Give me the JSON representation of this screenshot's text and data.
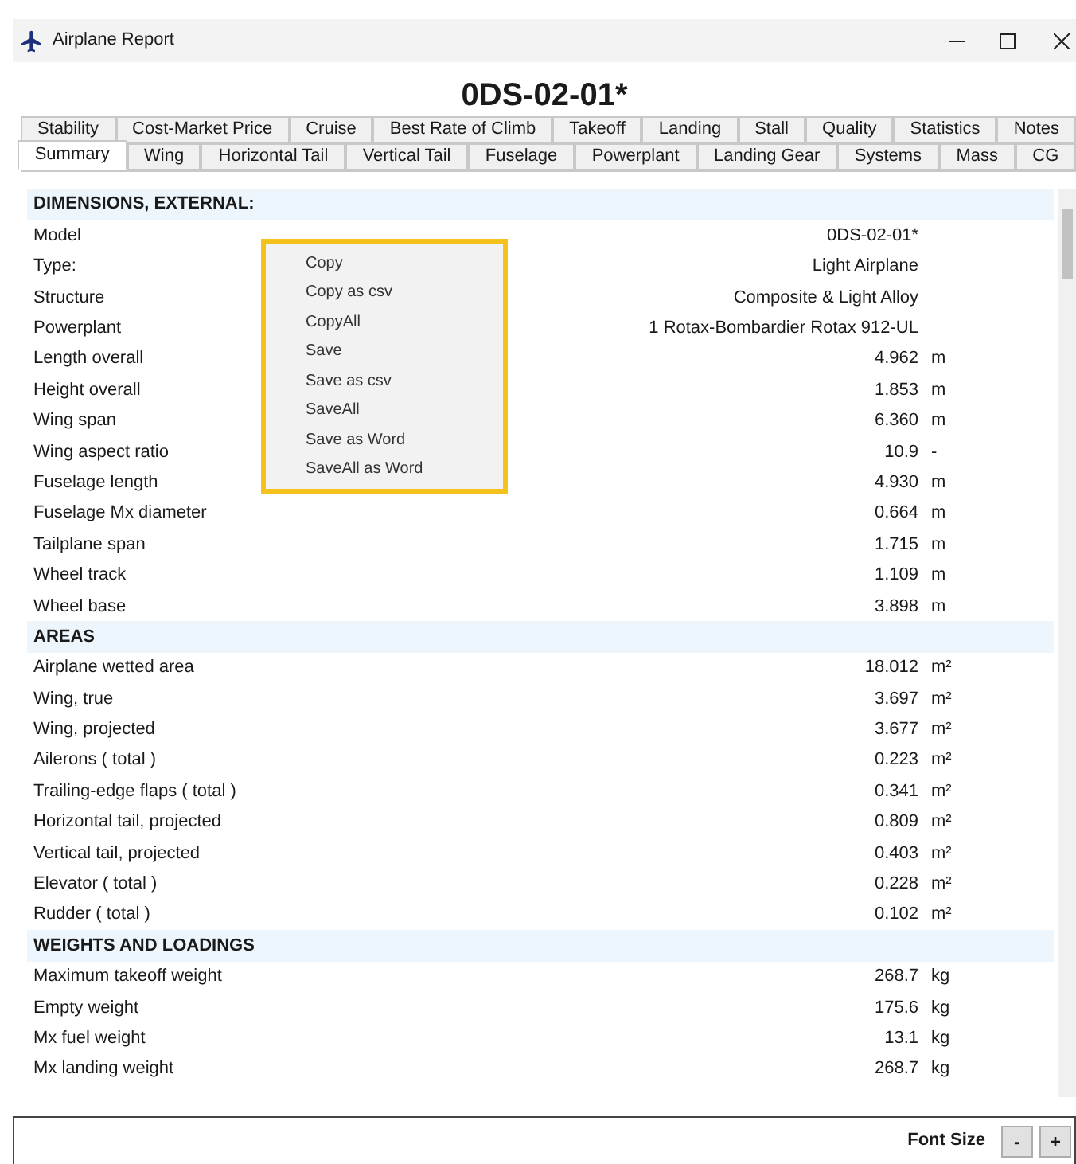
{
  "window": {
    "title": "Airplane Report"
  },
  "heading": "0DS-02-01*",
  "tab_rows": [
    [
      {
        "label": "Stability",
        "selected": false
      },
      {
        "label": "Cost-Market Price",
        "selected": false
      },
      {
        "label": "Cruise",
        "selected": false
      },
      {
        "label": "Best Rate of Climb",
        "selected": false
      },
      {
        "label": "Takeoff",
        "selected": false
      },
      {
        "label": "Landing",
        "selected": false
      },
      {
        "label": "Stall",
        "selected": false
      },
      {
        "label": "Quality",
        "selected": false
      },
      {
        "label": "Statistics",
        "selected": false
      },
      {
        "label": "Notes",
        "selected": false
      }
    ],
    [
      {
        "label": "Summary",
        "selected": true
      },
      {
        "label": "Wing",
        "selected": false
      },
      {
        "label": "Horizontal Tail",
        "selected": false
      },
      {
        "label": "Vertical Tail",
        "selected": false
      },
      {
        "label": "Fuselage",
        "selected": false
      },
      {
        "label": "Powerplant",
        "selected": false
      },
      {
        "label": "Landing Gear",
        "selected": false
      },
      {
        "label": "Systems",
        "selected": false
      },
      {
        "label": "Mass",
        "selected": false
      },
      {
        "label": "CG",
        "selected": false
      }
    ]
  ],
  "table": {
    "rows": [
      {
        "kind": "header",
        "label": "DIMENSIONS, EXTERNAL:"
      },
      {
        "kind": "row",
        "label": "Model",
        "value": "0DS-02-01*"
      },
      {
        "kind": "row",
        "label": "Type:",
        "value": "Light Airplane"
      },
      {
        "kind": "row",
        "label": "Structure",
        "value": "Composite & Light Alloy"
      },
      {
        "kind": "row",
        "label": "Powerplant",
        "value": "1 Rotax-Bombardier Rotax 912-UL"
      },
      {
        "kind": "row",
        "label": "Length overall",
        "value": "4.962",
        "unit": "m"
      },
      {
        "kind": "row",
        "label": "Height overall",
        "value": "1.853",
        "unit": "m"
      },
      {
        "kind": "row",
        "label": "Wing span",
        "value": "6.360",
        "unit": "m"
      },
      {
        "kind": "row",
        "label": "Wing aspect ratio",
        "value": "10.9",
        "unit": "-"
      },
      {
        "kind": "row",
        "label": "Fuselage length",
        "value": "4.930",
        "unit": "m"
      },
      {
        "kind": "row",
        "label": "Fuselage Mx diameter",
        "value": "0.664",
        "unit": "m"
      },
      {
        "kind": "row",
        "label": "Tailplane span",
        "value": "1.715",
        "unit": "m"
      },
      {
        "kind": "row",
        "label": "Wheel track",
        "value": "1.109",
        "unit": "m"
      },
      {
        "kind": "row",
        "label": "Wheel base",
        "value": "3.898",
        "unit": "m"
      },
      {
        "kind": "header",
        "label": "AREAS"
      },
      {
        "kind": "row",
        "label": "Airplane wetted area",
        "value": "18.012",
        "unit": "m²"
      },
      {
        "kind": "row",
        "label": "Wing, true",
        "value": "3.697",
        "unit": "m²"
      },
      {
        "kind": "row",
        "label": "Wing, projected",
        "value": "3.677",
        "unit": "m²"
      },
      {
        "kind": "row",
        "label": "Ailerons ( total )",
        "value": "0.223",
        "unit": "m²"
      },
      {
        "kind": "row",
        "label": "Trailing-edge flaps ( total )",
        "value": "0.341",
        "unit": "m²"
      },
      {
        "kind": "row",
        "label": "Horizontal tail, projected",
        "value": "0.809",
        "unit": "m²"
      },
      {
        "kind": "row",
        "label": "Vertical tail, projected",
        "value": "0.403",
        "unit": "m²"
      },
      {
        "kind": "row",
        "label": "Elevator ( total )",
        "value": "0.228",
        "unit": "m²"
      },
      {
        "kind": "row",
        "label": "Rudder ( total )",
        "value": "0.102",
        "unit": "m²"
      },
      {
        "kind": "header",
        "label": "WEIGHTS AND LOADINGS"
      },
      {
        "kind": "row",
        "label": "Maximum takeoff weight",
        "value": "268.7",
        "unit": "kg"
      },
      {
        "kind": "row",
        "label": "Empty weight",
        "value": "175.6",
        "unit": "kg"
      },
      {
        "kind": "row",
        "label": "Mx fuel weight",
        "value": "13.1",
        "unit": "kg"
      },
      {
        "kind": "row",
        "label": "Mx landing weight",
        "value": "268.7",
        "unit": "kg"
      }
    ]
  },
  "context_menu": {
    "items": [
      "Copy",
      "Copy as csv",
      "CopyAll",
      "Save",
      "Save as csv",
      "SaveAll",
      "Save as Word",
      "SaveAll as Word"
    ]
  },
  "footer": {
    "label": "Font Size",
    "buttons": [
      "-",
      "+"
    ]
  }
}
